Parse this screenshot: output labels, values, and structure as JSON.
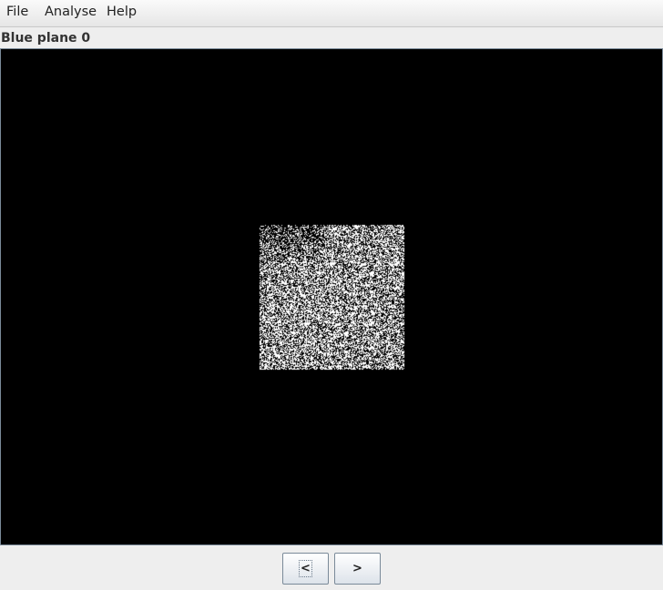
{
  "menu": {
    "items": [
      "File",
      "Analyse",
      "Help"
    ]
  },
  "viewer": {
    "title": "Blue plane 0",
    "background_color": "#000000",
    "noise_color": "#ffffff"
  },
  "navigation": {
    "prev_label": "<",
    "next_label": ">"
  }
}
